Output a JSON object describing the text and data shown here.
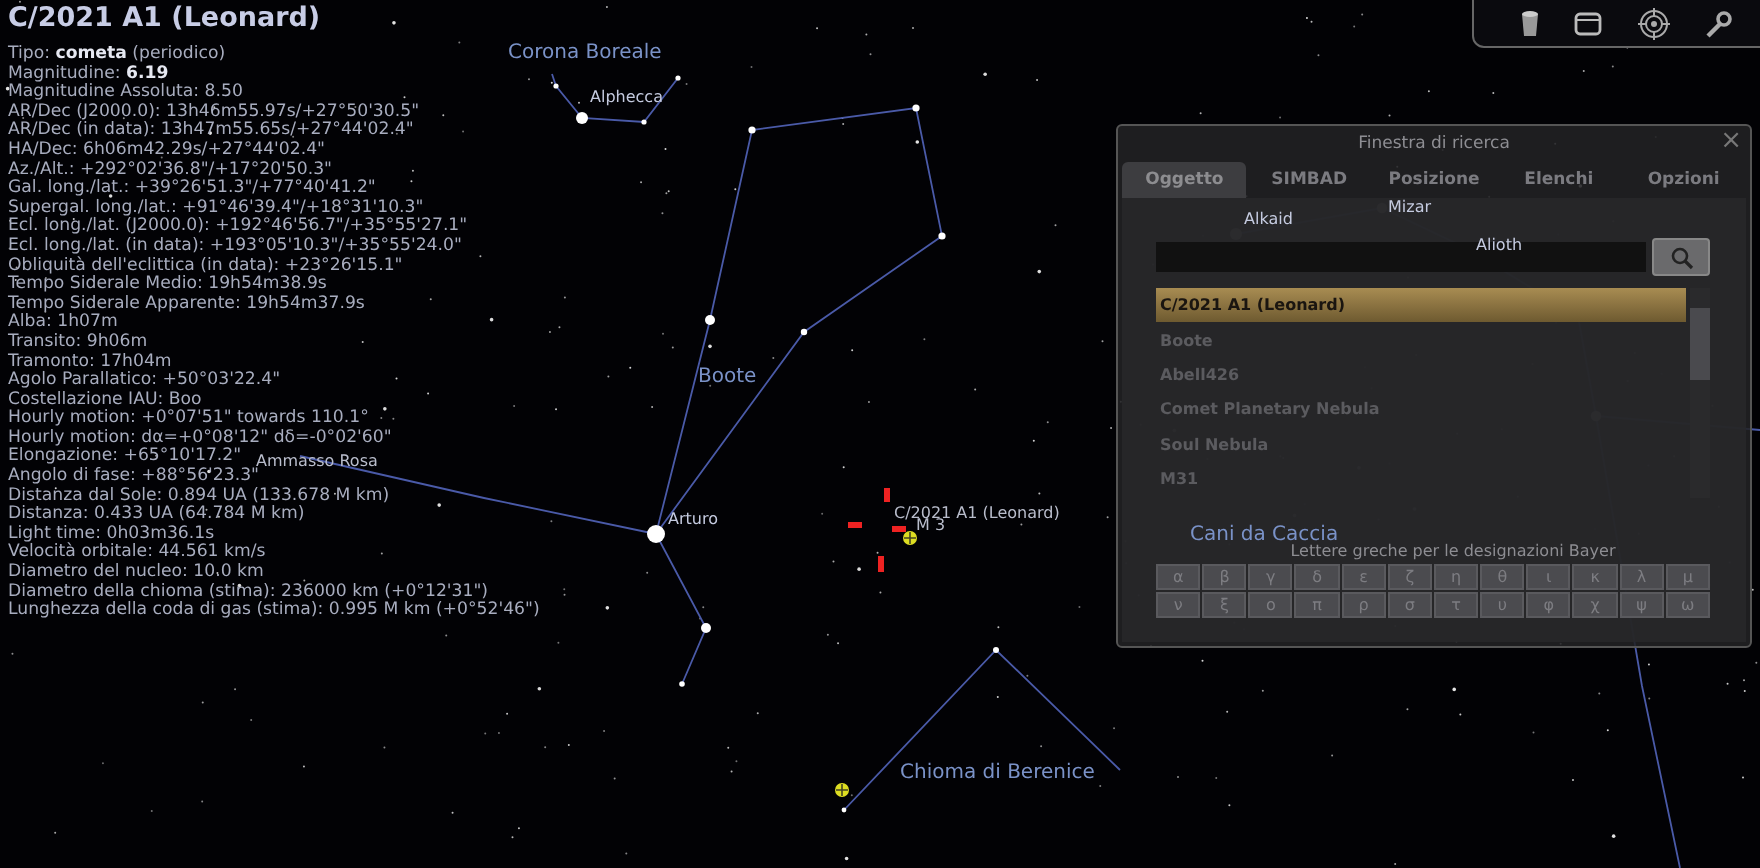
{
  "title": "C/2021 A1 (Leonard)",
  "info_lines": [
    "Tipo: **cometa** (periodico)",
    "Magnitudine: **6.19**",
    "Magnitudine Assoluta: 8.50",
    "AR/Dec (J2000.0): 13h46m55.97s/+27°50'30.5\"",
    "AR/Dec (in data): 13h47m55.65s/+27°44'02.4\"",
    "HA/Dec: 6h06m42.29s/+27°44'02.4\"",
    "Az./Alt.: +292°02'36.8\"/+17°20'50.3\"",
    "Gal. long./lat.: +39°26'51.3\"/+77°40'41.2\"",
    "Supergal. long./lat.: +91°46'39.4\"/+18°31'10.3\"",
    "Ecl. long./lat. (J2000.0): +192°46'56.7\"/+35°55'27.1\"",
    "Ecl. long./lat. (in data): +193°05'10.3\"/+35°55'24.0\"",
    "Obliquità dell'eclittica (in data): +23°26'15.1\"",
    "Tempo Siderale Medio: 19h54m38.9s",
    "Tempo Siderale Apparente: 19h54m37.9s",
    "Alba: 1h07m",
    "Transito: 9h06m",
    "Tramonto: 17h04m",
    "Agolo Parallatico: +50°03'22.4\"",
    "Costellazione IAU: Boo",
    "Hourly motion: +0°07'51\" towards 110.1°",
    "Hourly motion: dα=+0°08'12\" dδ=-0°02'60\"",
    "Elongazione: +65°10'17.2\"",
    "Angolo di fase: +88°56'23.3\"",
    "Distanza dal Sole: 0.894 UA (133.678 M km)",
    "Distanza: 0.433 UA (64.784 M km)",
    "Light time: 0h03m36.1s",
    "Velocità orbitale: 44.561 km/s",
    "Diametro del nucleo: 10.0 km",
    "Diametro della chioma (stima): 236000 km (+0°12'31\")",
    "Lunghezza della coda di gas (stima): 0.995 M km (+0°52'46\")"
  ],
  "sky_labels": [
    {
      "kind": "constellation",
      "text": "Corona Boreale"
    },
    {
      "kind": "star",
      "text": "Alphecca"
    },
    {
      "kind": "constellation",
      "text": "Boote"
    },
    {
      "kind": "star",
      "text": "Arturo"
    },
    {
      "kind": "object",
      "text": "C/2021 A1 (Leonard)"
    },
    {
      "kind": "object",
      "text": "M 3"
    },
    {
      "kind": "constellation",
      "text": "Chioma di Berenice"
    },
    {
      "kind": "object",
      "text": "Ammasso Rosa"
    },
    {
      "kind": "star",
      "text": "Alkaid"
    },
    {
      "kind": "star",
      "text": "Mizar"
    },
    {
      "kind": "star",
      "text": "Alioth"
    },
    {
      "kind": "constellation",
      "text": "Cani da Caccia"
    }
  ],
  "search_window": {
    "title": "Finestra di ricerca",
    "close": "×",
    "tabs": [
      {
        "label": "Oggetto",
        "selected": true
      },
      {
        "label": "SIMBAD",
        "selected": false
      },
      {
        "label": "Posizione",
        "selected": false
      },
      {
        "label": "Elenchi",
        "selected": false
      },
      {
        "label": "Opzioni",
        "selected": false
      }
    ],
    "results": [
      {
        "label": "C/2021 A1 (Leonard)",
        "selected": true
      },
      {
        "label": "Boote",
        "selected": false
      },
      {
        "label": "Abell426",
        "selected": false
      },
      {
        "label": "Comet Planetary Nebula",
        "selected": false
      },
      {
        "label": "Soul Nebula",
        "selected": false
      },
      {
        "label": "M31",
        "selected": false
      }
    ],
    "greek_label": "Lettere greche per le designazioni Bayer",
    "greek_letters": [
      "α",
      "β",
      "γ",
      "δ",
      "ε",
      "ζ",
      "η",
      "θ",
      "ι",
      "κ",
      "λ",
      "μ",
      "ν",
      "ξ",
      "ο",
      "π",
      "ρ",
      "σ",
      "τ",
      "υ",
      "φ",
      "χ",
      "ψ",
      "ω"
    ]
  }
}
